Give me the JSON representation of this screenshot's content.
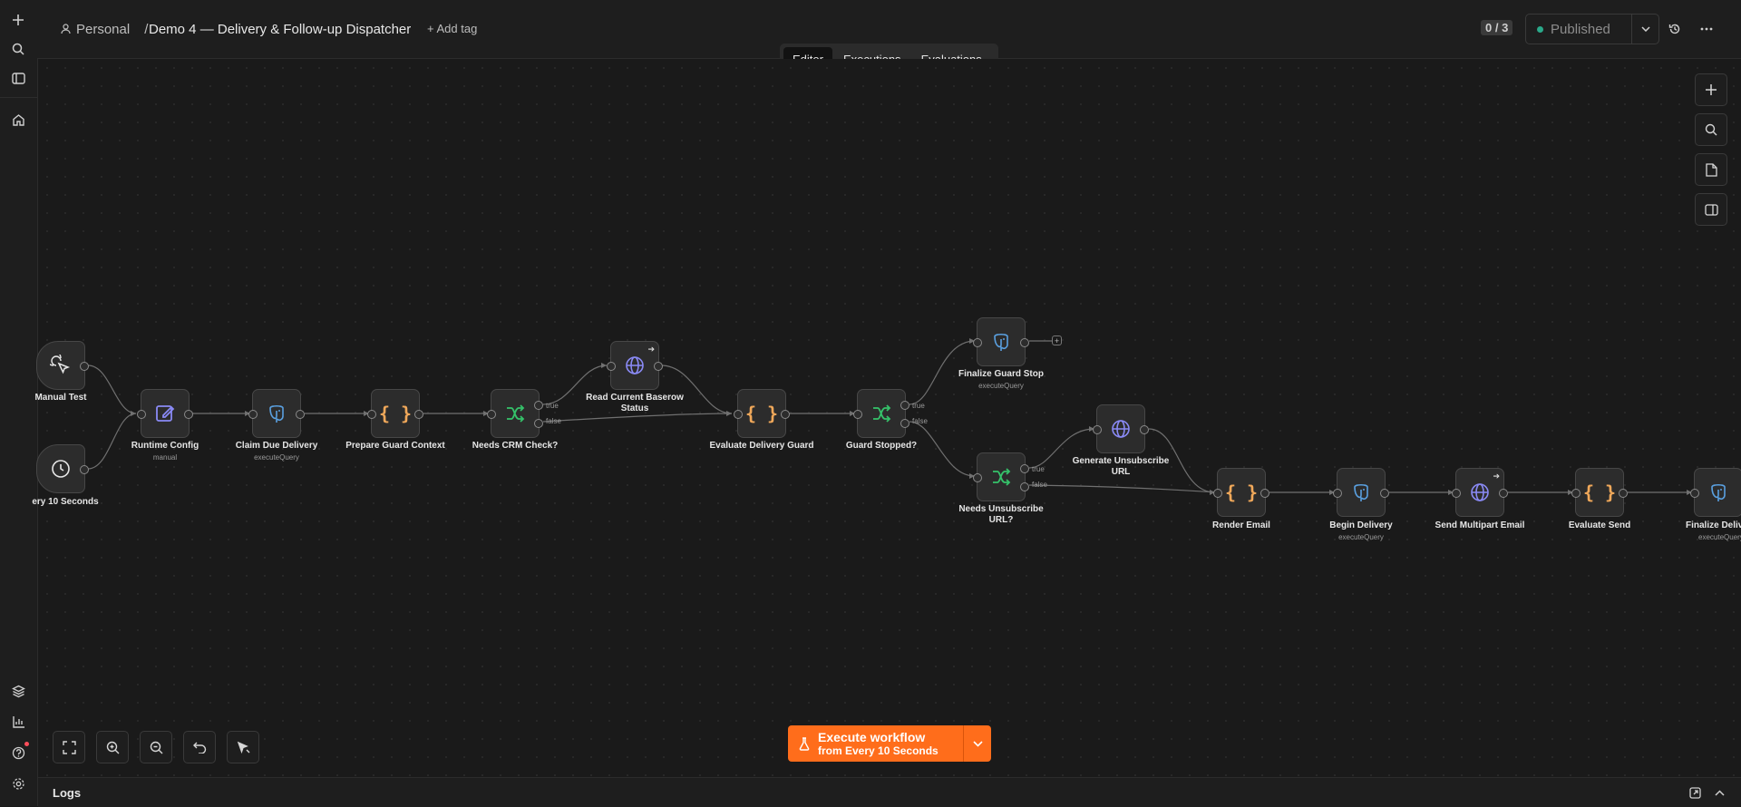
{
  "header": {
    "project": "Personal",
    "workflow_title": "Demo 4 — Delivery & Follow-up Dispatcher",
    "add_tag": "+ Add tag",
    "counter": "0 / 3",
    "publish_label": "Published"
  },
  "tabs": [
    {
      "label": "Editor",
      "active": true
    },
    {
      "label": "Executions",
      "active": false
    },
    {
      "label": "Evaluations",
      "active": false
    }
  ],
  "nodes": {
    "manual_test": {
      "label": "Manual Test",
      "icon": "pointer-click-icon"
    },
    "every_10s": {
      "label": "ery 10 Seconds",
      "icon": "clock-icon"
    },
    "runtime_config": {
      "label": "Runtime Config",
      "sub": "manual",
      "icon": "edit-icon"
    },
    "claim_due": {
      "label": "Claim Due Delivery",
      "sub": "executeQuery",
      "icon": "postgres-icon"
    },
    "prepare_guard": {
      "label": "Prepare Guard Context",
      "icon": "code-braces-icon"
    },
    "needs_crm": {
      "label": "Needs CRM Check?",
      "icon": "if-branch-icon",
      "true_label": "true",
      "false_label": "false"
    },
    "read_baserow": {
      "label": "Read Current Baserow Status",
      "icon": "globe-icon"
    },
    "evaluate_guard": {
      "label": "Evaluate Delivery Guard",
      "icon": "code-braces-icon"
    },
    "guard_stopped": {
      "label": "Guard Stopped?",
      "icon": "if-branch-icon",
      "true_label": "true",
      "false_label": "false"
    },
    "finalize_guard": {
      "label": "Finalize Guard Stop",
      "sub": "executeQuery",
      "icon": "postgres-icon"
    },
    "needs_unsub": {
      "label": "Needs Unsubscribe URL?",
      "icon": "if-branch-icon",
      "true_label": "true",
      "false_label": "false"
    },
    "gen_unsub": {
      "label": "Generate Unsubscribe URL",
      "icon": "globe-icon"
    },
    "render_email": {
      "label": "Render Email",
      "icon": "code-braces-icon"
    },
    "begin_delivery": {
      "label": "Begin Delivery",
      "sub": "executeQuery",
      "icon": "postgres-icon"
    },
    "send_multipart": {
      "label": "Send Multipart Email",
      "icon": "globe-icon"
    },
    "evaluate_send": {
      "label": "Evaluate Send",
      "icon": "code-braces-icon"
    },
    "finalize_delivery": {
      "label": "Finalize Delive",
      "sub": "executeQuery",
      "icon": "postgres-icon"
    }
  },
  "execute": {
    "title": "Execute workflow",
    "subtitle": "from Every 10 Seconds"
  },
  "logs": {
    "label": "Logs"
  },
  "colors": {
    "accent": "#ff6d1b",
    "code": "#f0a85a",
    "branch": "#35c26a",
    "http": "#8a8af5",
    "postgres": "#5aa0e0"
  }
}
